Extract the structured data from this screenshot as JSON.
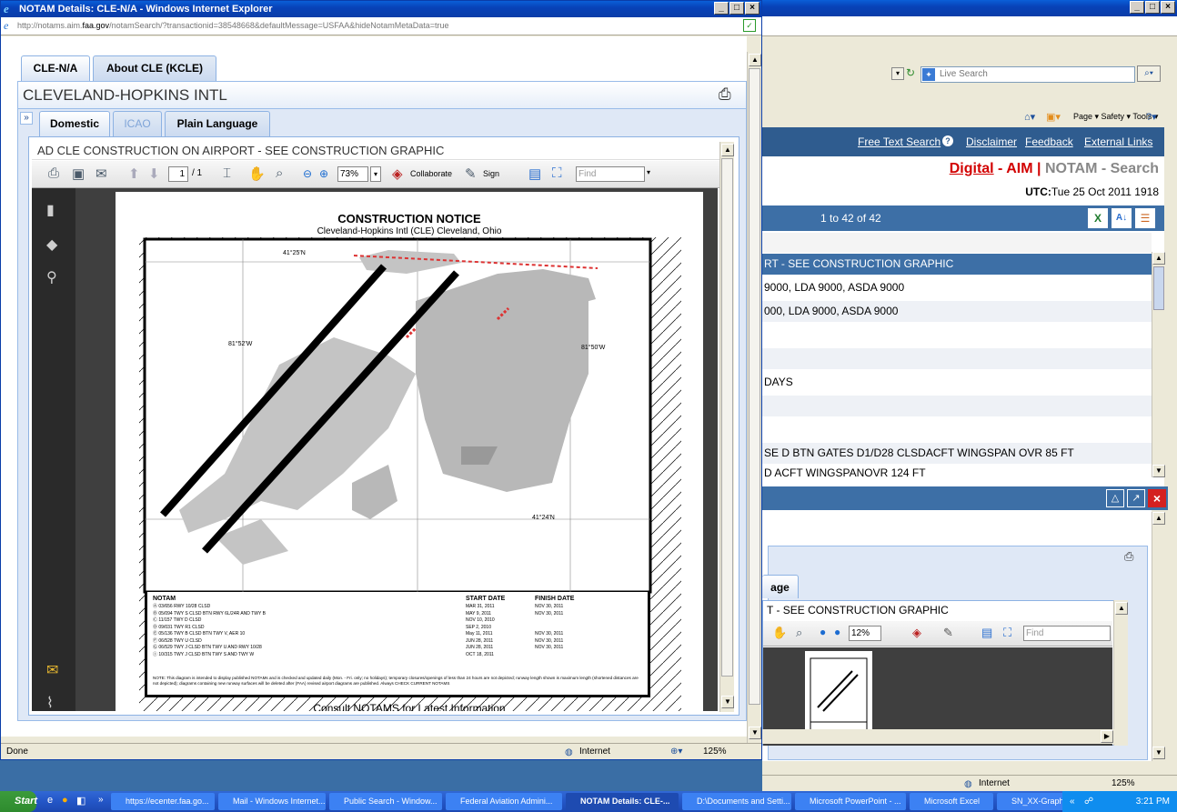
{
  "back_window": {
    "search_placeholder": "Live Search",
    "toolbar_items": "Page ▾  Safety ▾  Tools ▾",
    "links": [
      "Free Text Search",
      "Disclaimer",
      "Feedback",
      "External Links"
    ],
    "brand_digital": "Digital",
    "brand_aim": " - AIM | ",
    "brand_rest": "NOTAM - Search",
    "utc_label": "UTC:",
    "utc_value": "Tue 25 Oct 2011 1918",
    "count": "1 to 42 of 42",
    "rows": [
      "RT - SEE CONSTRUCTION GRAPHIC",
      "9000, LDA 9000, ASDA 9000",
      "000, LDA 9000, ASDA 9000",
      "",
      "",
      "DAYS",
      "",
      "",
      "SE D BTN GATES D1/D28 CLSDACFT WINGSPAN OVR 85 FT",
      "D ACFT WINGSPANOVR 124 FT"
    ],
    "sub_tab": "age",
    "sub_title": "T - SEE CONSTRUCTION GRAPHIC",
    "sub_zoom": "12%",
    "sub_find": "Find",
    "status_zone": "Internet",
    "status_zoom": "125%"
  },
  "front_window": {
    "title": "NOTAM Details: CLE-N/A - Windows Internet Explorer",
    "url_pre": "http://notams.aim.",
    "url_host": "faa.gov",
    "url_post": "/notamSearch/?transactionid=38548668&defaultMessage=USFAA&hideNotamMetaData=true",
    "tabs": [
      "CLE-N/A",
      "About CLE (KCLE)"
    ],
    "airport_name": "CLEVELAND-HOPKINS INTL",
    "sub_tabs": [
      "Domestic",
      "ICAO",
      "Plain Language"
    ],
    "notam_title": "AD CLE CONSTRUCTION ON AIRPORT - SEE CONSTRUCTION GRAPHIC",
    "page_current": "1",
    "page_total": "/ 1",
    "zoom": "73%",
    "collaborate": "Collaborate",
    "sign": "Sign",
    "find": "Find",
    "status_left": "Done",
    "status_zone": "Internet",
    "status_zoom": "125%"
  },
  "document": {
    "heading": "CONSTRUCTION NOTICE",
    "subheading": "Cleveland-Hopkins Intl (CLE)   Cleveland, Ohio",
    "lat_top": "41°25'N",
    "lat_bottom": "41°24'N",
    "lon_left": "81°52'W",
    "lon_right": "81°50'W",
    "col_notam": "NOTAM",
    "col_start": "START DATE",
    "col_finish": "FINISH DATE",
    "notams": [
      {
        "text": "Ⓐ 03/656  RWY 10/28 CLSD",
        "start": "MAR 31, 2011",
        "finish": "NOV 30, 2011"
      },
      {
        "text": "Ⓑ 05/094  TWY S CLSD BTN RWY 6L/24R AND TWY B",
        "start": "MAY 9, 2011",
        "finish": "NOV 30, 2011"
      },
      {
        "text": "Ⓒ 11/157  TWY D CLSD",
        "start": "NOV 10, 2010",
        "finish": ""
      },
      {
        "text": "Ⓓ 09/031  TWY R1 CLSD",
        "start": "SEP 2, 2010",
        "finish": ""
      },
      {
        "text": "Ⓔ 05/136  TWY B CLSD BTN TWY V, AER 10",
        "start": "May 11, 2011",
        "finish": "NOV 30, 2011"
      },
      {
        "text": "Ⓕ 06/528  TWY U CLSD",
        "start": "JUN 28, 2011",
        "finish": "NOV 30, 2011"
      },
      {
        "text": "Ⓖ 06/529  TWY J CLSD BTN TWY U AND RWY 10/28",
        "start": "JUN 28, 2011",
        "finish": "NOV 30, 2011"
      },
      {
        "text": "Ⓘ 10/315  TWY J CLSD BTN TWY S AND TWY W",
        "start": "OCT 18, 2011",
        "finish": ""
      }
    ],
    "note": "NOTE:  This diagram is intended to display published NOTAMs and is checked and updated daily (Mon. - Fri. only; no holidays); temporary closures/openings of less than 24 hours are not depicted; runway length shown is maximum length (shortened distances are not depicted); diagrams containing new runway surfaces will be deleted after (FAA) revised airport diagrams are published. Always CHECK CURRENT NOTAMS",
    "footer": "Consult NOTAMS for Latest Information"
  },
  "taskbar": {
    "start": "Start",
    "buttons": [
      "https://ecenter.faa.go...",
      "Mail - Windows Internet...",
      "Public Search - Window...",
      "Federal Aviation Admini...",
      "NOTAM Details: CLE-...",
      "D:\\Documents and Setti...",
      "Microsoft PowerPoint - ...",
      "Microsoft Excel",
      "SN_XX-Graphical NOTA..."
    ],
    "time": "3:21 PM"
  }
}
